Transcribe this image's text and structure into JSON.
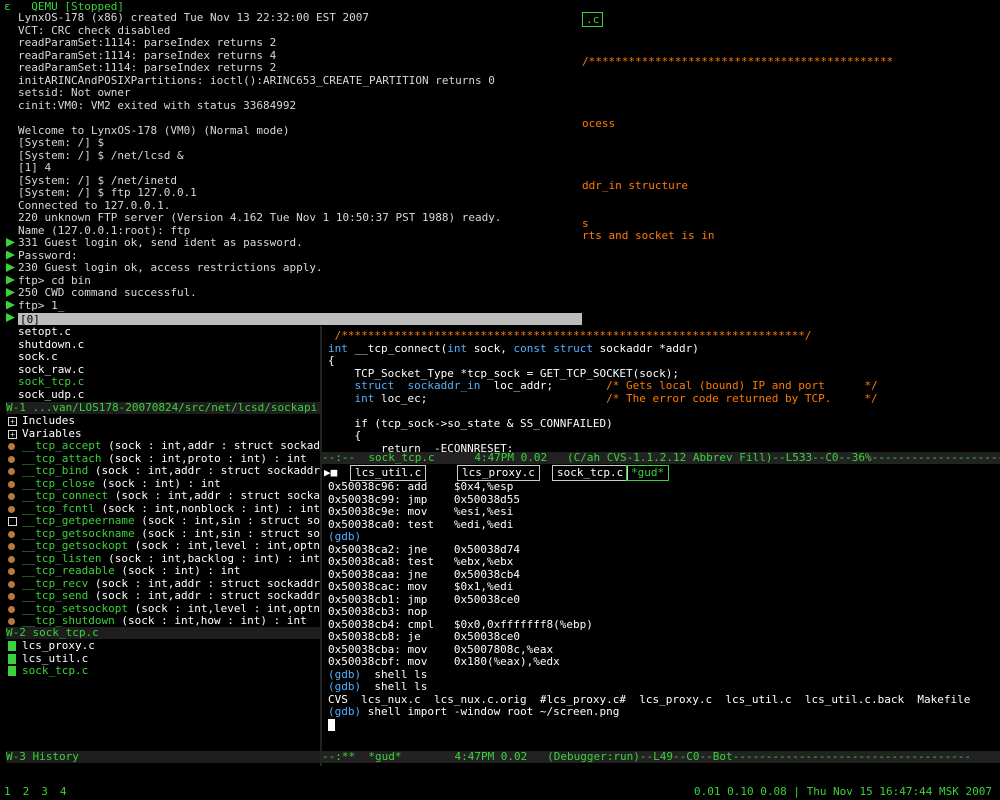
{
  "qemu_title": "QEMU [Stopped]",
  "qemu_icon": "ɛ",
  "bg_fragments": {
    "file_tab": ".c",
    "stars": "/**********************************************",
    "process": "ocess",
    "sockaddr": "ddr_in structure",
    "s": "s",
    "ports": "rts and socket is in"
  },
  "console_lines": [
    "LynxOS-178 (x86) created Tue Nov 13 22:32:00 EST 2007",
    "VCT: CRC check disabled",
    "readParamSet:1114: parseIndex returns 2",
    "readParamSet:1114: parseIndex returns 4",
    "readParamSet:1114: parseIndex returns 2",
    "initARINCAndPOSIXPartitions: ioctl():ARINC653_CREATE_PARTITION returns 0",
    "setsid: Not owner",
    "cinit:VM0: VM2 exited with status 33684992",
    "",
    "Welcome to LynxOS-178 (VM0) (Normal mode)",
    "[System: /] $",
    "[System: /] $ /net/lcsd &",
    "[1] 4",
    "[System: /] $ /net/inetd",
    "[System: /] $ ftp 127.0.0.1",
    "Connected to 127.0.0.1.",
    "220 unknown FTP server (Version 4.162 Tue Nov 1 10:50:37 PST 1988) ready.",
    "Name (127.0.0.1:root): ftp",
    "331 Guest login ok, send ident as password.",
    "Password:",
    "230 Guest login ok, access restrictions apply.",
    "ftp> cd bin",
    "250 CWD command successful.",
    "ftp> 1_"
  ],
  "selection_bar": "[0]",
  "speedbar_files_top": [
    "setopt.c",
    "shutdown.c",
    "sock.c",
    "sock_raw.c",
    "sock_tcp.c",
    "sock_udp.c"
  ],
  "modeline_w1": "W-1 ...van/LOS178-20070824/src/net/lcsd/sockapi",
  "tag_tree": [
    {
      "icon": "box-plus",
      "name": "Includes",
      "args": ""
    },
    {
      "icon": "box-plus",
      "name": "Variables",
      "args": ""
    },
    {
      "icon": "tag",
      "name": "__tcp_accept",
      "args": " (sock : int,addr : struct sockaddr*)"
    },
    {
      "icon": "tag",
      "name": "__tcp_attach",
      "args": " (sock : int,proto : int) : int"
    },
    {
      "icon": "tag",
      "name": "__tcp_bind",
      "args": " (sock : int,addr : struct sockaddr*) : int"
    },
    {
      "icon": "tag",
      "name": "__tcp_close",
      "args": " (sock : int) : int"
    },
    {
      "icon": "tag",
      "name": "__tcp_connect",
      "args": " (sock : int,addr : struct sockaddr"
    },
    {
      "icon": "tag",
      "name": "__tcp_fcntl",
      "args": " (sock : int,nonblock : int) : int"
    },
    {
      "icon": "box",
      "name": "__tcp_getpeername",
      "args": " (sock : int,sin : struct socke"
    },
    {
      "icon": "tag",
      "name": "__tcp_getsockname",
      "args": " (sock : int,sin : struct socke"
    },
    {
      "icon": "tag",
      "name": "__tcp_getsockopt",
      "args": " (sock : int,level : int,optname"
    },
    {
      "icon": "tag",
      "name": "__tcp_listen",
      "args": " (sock : int,backlog : int) : int"
    },
    {
      "icon": "tag",
      "name": "__tcp_readable",
      "args": " (sock : int) : int"
    },
    {
      "icon": "tag",
      "name": "__tcp_recv",
      "args": " (sock : int,addr : struct sockaddr*,t"
    },
    {
      "icon": "tag",
      "name": "__tcp_send",
      "args": " (sock : int,addr : struct sockaddr*,t"
    },
    {
      "icon": "tag",
      "name": "__tcp_setsockopt",
      "args": " (sock : int,level : int,optname"
    },
    {
      "icon": "tag",
      "name": "__tcp_shutdown",
      "args": " (sock : int,how : int) : int"
    }
  ],
  "modeline_w2": "W-2 sock_tcp.c",
  "speedbar_files_bottom": [
    "lcs_proxy.c",
    "lcs_util.c",
    "sock_tcp.c"
  ],
  "modeline_w3": "W-3 History",
  "source_lines": [
    {
      "cls": "orange",
      "text": " /**********************************************************************/"
    },
    {
      "cls": "src",
      "text": "int __tcp_connect(int sock, const struct sockaddr *addr)"
    },
    {
      "cls": "white",
      "text": "{"
    },
    {
      "cls": "white",
      "text": "    TCP_Socket_Type *tcp_sock = GET_TCP_SOCKET(sock);"
    },
    {
      "cls": "decl1",
      "text": "    struct  sockaddr_in  loc_addr;        /* Gets local (bound) IP and port      */"
    },
    {
      "cls": "decl2",
      "text": "    int loc_ec;                           /* The error code returned by TCP.     */"
    },
    {
      "cls": "white",
      "text": ""
    },
    {
      "cls": "white",
      "text": "    if (tcp_sock->so_state & SS_CONNFAILED)"
    },
    {
      "cls": "white",
      "text": "    {"
    },
    {
      "cls": "white",
      "text": "        return  -ECONNRESET;"
    }
  ],
  "modeline_source": "--:--  sock_tcp.c      4:47PM 0.02   (C/ah CVS-1.1.2.12 Abbrev Fill)--L533--C0--36%------------------------",
  "gud_tabs": [
    "lcs_util.c",
    "lcs_proxy.c",
    "sock_tcp.c",
    "*gud*"
  ],
  "gud_lines": [
    {
      "cls": "white",
      "text": "0x50038c96: add    $0x4,%esp"
    },
    {
      "cls": "white",
      "text": "0x50038c99: jmp    0x50038d55"
    },
    {
      "cls": "white",
      "text": "0x50038c9e: mov    %esi,%esi"
    },
    {
      "cls": "white",
      "text": "0x50038ca0: test   %edi,%edi"
    },
    {
      "cls": "cyan",
      "text": "(gdb)"
    },
    {
      "cls": "white",
      "text": "0x50038ca2: jne    0x50038d74"
    },
    {
      "cls": "white",
      "text": "0x50038ca8: test   %ebx,%ebx"
    },
    {
      "cls": "white",
      "text": "0x50038caa: jne    0x50038cb4"
    },
    {
      "cls": "white",
      "text": "0x50038cac: mov    $0x1,%edi"
    },
    {
      "cls": "white",
      "text": "0x50038cb1: jmp    0x50038ce0"
    },
    {
      "cls": "white",
      "text": "0x50038cb3: nop"
    },
    {
      "cls": "white",
      "text": "0x50038cb4: cmpl   $0x0,0xfffffff8(%ebp)"
    },
    {
      "cls": "white",
      "text": "0x50038cb8: je     0x50038ce0"
    },
    {
      "cls": "white",
      "text": "0x50038cba: mov    0x5007808c,%eax"
    },
    {
      "cls": "white",
      "text": "0x50038cbf: mov    0x180(%eax),%edx"
    },
    {
      "cls": "gdbcmd",
      "text": "(gdb)  shell ls"
    },
    {
      "cls": "gdbcmd",
      "text": "(gdb)  shell ls"
    },
    {
      "cls": "white",
      "text": "CVS  lcs_nux.c  lcs_nux.c.orig  #lcs_proxy.c#  lcs_proxy.c  lcs_util.c  lcs_util.c.back  Makefile"
    },
    {
      "cls": "gdbcmd",
      "text": "(gdb) shell import -window root ~/screen.png"
    }
  ],
  "modeline_gud": "--:**  *gud*        4:47PM 0.02   (Debugger:run)--L49--C0--Bot------------------------------------",
  "workspaces": [
    "1",
    "2",
    "3",
    "4"
  ],
  "sysinfo": "0.01 0.10 0.08 | Thu Nov 15 16:47:44 MSK 2007",
  "colors": {
    "accent_green": "#3bd23b",
    "keyword_cyan": "#4fb0ff",
    "comment_orange": "#ff7a00"
  }
}
